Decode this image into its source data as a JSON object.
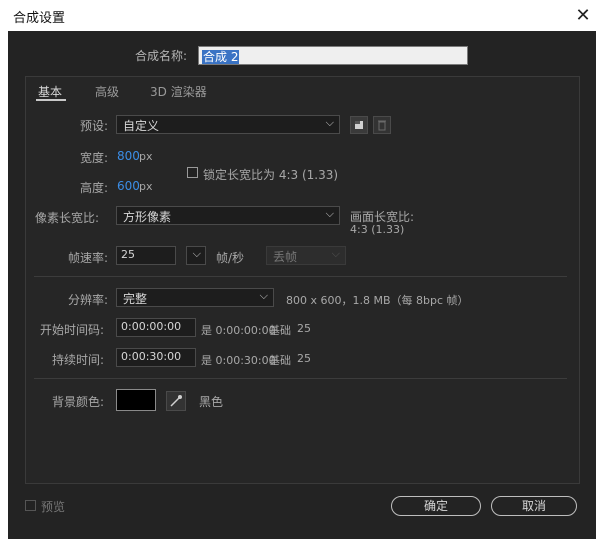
{
  "window": {
    "title": "合成设置",
    "close_glyph": "✕"
  },
  "comp_name": {
    "label": "合成名称:",
    "value": "合成 2"
  },
  "tabs": [
    {
      "label": "基本"
    },
    {
      "label": "高级"
    },
    {
      "label": "3D 渲染器"
    }
  ],
  "preset": {
    "label": "预设:",
    "value": "自定义"
  },
  "width": {
    "label": "宽度:",
    "value": "800",
    "unit": "px"
  },
  "height": {
    "label": "高度:",
    "value": "600",
    "unit": "px"
  },
  "lock_aspect": {
    "label": "锁定长宽比为 4:3 (1.33)",
    "checked": false
  },
  "pixel_aspect": {
    "label": "像素长宽比:",
    "value": "方形像素"
  },
  "frame_aspect": {
    "label": "画面长宽比:",
    "value": "4:3 (1.33)"
  },
  "frame_rate": {
    "label": "帧速率:",
    "value": "25",
    "unit": "帧/秒",
    "drop_frame": "丢帧"
  },
  "resolution": {
    "label": "分辨率:",
    "value": "完整",
    "info": "800 x 600，1.8 MB（每 8bpc 帧）"
  },
  "start_timecode": {
    "label": "开始时间码:",
    "value": "0:00:00:00",
    "is_text": "是 0:00:00:00",
    "base_label": "基础",
    "base": "25"
  },
  "duration": {
    "label": "持续时间:",
    "value": "0:00:30:00",
    "is_text": "是 0:00:30:00",
    "base_label": "基础",
    "base": "25"
  },
  "background_color": {
    "label": "背景颜色:",
    "name": "黑色",
    "swatch": "#000000"
  },
  "preview": {
    "label": "预览",
    "checked": false
  },
  "buttons": {
    "ok": "确定",
    "cancel": "取消"
  },
  "colors": {
    "accent_blue": "#3b8de6",
    "selection": "#3a73c4",
    "dialog_bg": "#232323"
  }
}
